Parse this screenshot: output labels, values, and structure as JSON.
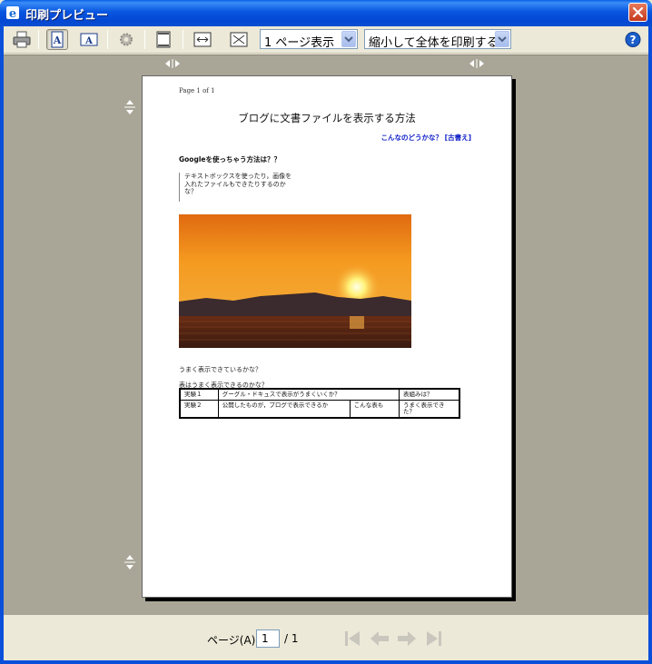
{
  "window": {
    "title": "印刷プレビュー",
    "accent": "#0a4fd9"
  },
  "toolbar": {
    "print_icon": "printer-icon",
    "portrait_icon": "portrait-page-icon",
    "landscape_icon": "landscape-page-icon",
    "page_setup_icon": "gear-icon",
    "header_footer_icon": "header-footer-icon",
    "full_width_icon": "full-width-icon",
    "full_page_icon": "full-page-icon",
    "view_select": "1 ページ表示",
    "scale_select": "縮小して全体を印刷する",
    "help_icon": "help-icon"
  },
  "document": {
    "page_header": "Page 1 of 1",
    "title": "ブログに文書ファイルを表示する方法",
    "link": "こんなのどうかな？ [古書え]",
    "section_title": "Googleを使っちゃう方法は？？",
    "quote_lines": [
      "テキストボックスを使ったり，画像を",
      "入れたファイルもできたりするのか",
      "な？"
    ],
    "image_alt": "sunset-photo",
    "line1": "うまく表示できているかな？",
    "line2": "表はうまく表示できるのかな？",
    "table": [
      [
        "実験１",
        "グーグル・ドキュスで表示がうまくいくか？",
        "表組みは？"
      ],
      [
        "実験２",
        "公開したものが，ブログで表示できるか",
        "こんな表も",
        "うまく表示できた？"
      ]
    ]
  },
  "navigation": {
    "page_label": "ページ(A)",
    "current_page": "1",
    "total": "/ 1",
    "first_icon": "first-page-icon",
    "prev_icon": "prev-page-icon",
    "next_icon": "next-page-icon",
    "last_icon": "last-page-icon"
  }
}
